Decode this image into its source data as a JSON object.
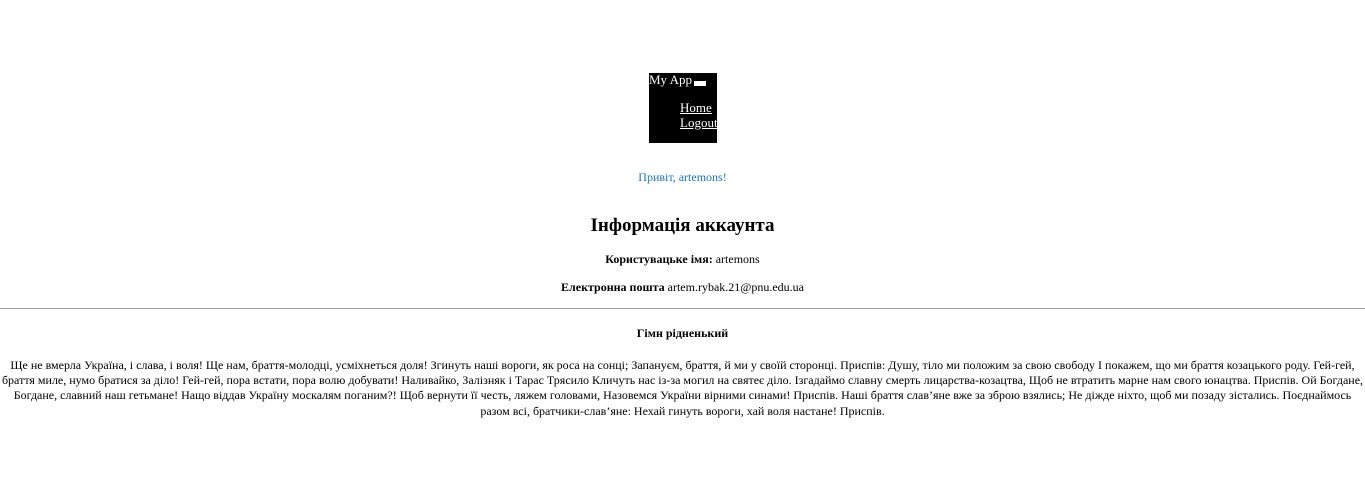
{
  "navbar": {
    "brand": "My App",
    "toggler_icon": "menu-toggle-icon",
    "items": [
      {
        "label": "Home"
      },
      {
        "label": "Logout"
      }
    ]
  },
  "greeting": "Привіт, artemons!",
  "account": {
    "title": "Інформація аккаунта",
    "username_label": "Користувацьке імя:",
    "username_value": "artemons",
    "email_label": "Електронна пошта",
    "email_value": "artem.rybak.21@pnu.edu.ua"
  },
  "anthem": {
    "title": "Гімн рідненький",
    "text": "Ще не вмерла Україна, і слава, і воля! Ще нам, браття-молодці, усміхнеться доля! Згинуть наші вороги, як роса на сонці; Запануєм, браття, й ми у своїй сторонці. Приспів: Душу, тіло ми положим за свою свободу І покажем, що ми браття козацького роду. Гей-гей, браття миле, нумо братися за діло! Гей-гей, пора встати, пора волю добувати! Наливайко, Залізняк і Тарас Трясило Кличуть нас із-за могил на святеє діло. Ізгадаймо славну смерть лицарства-козацтва, Щоб не втратить марне нам свого юнацтва. Приспів. Ой Богдане, Богдане, славний наш гетьмане! Нащо віддав Україну москалям поганим?! Щоб вернути її честь, ляжем головами, Назовемся України вірними синами! Приспів. Наші браття слав’яне вже за зброю взялись; Не діжде ніхто, щоб ми позаду зістались. Поєднаймось разом всі, братчики-слав’яне: Нехай гинуть вороги, хай воля настане! Приспів."
  },
  "colors": {
    "navbar_bg": "#000000",
    "greeting": "#1a73c8"
  }
}
